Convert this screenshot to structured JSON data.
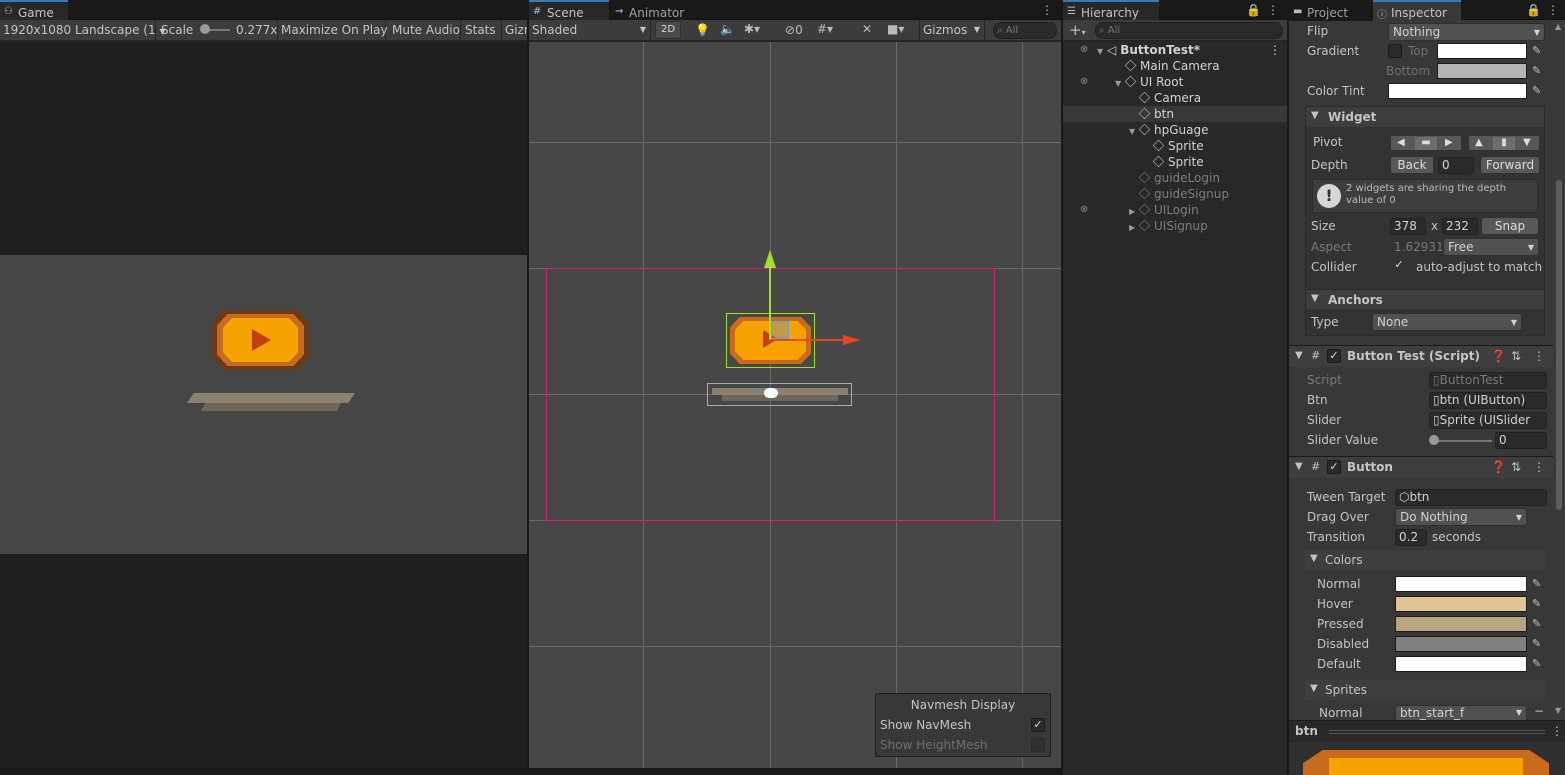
{
  "game": {
    "tab": "Game",
    "resolution": "1920x1080 Landscape (1",
    "scale_label": "Scale",
    "scale_value": "0.277x",
    "maximize": "Maximize On Play",
    "mute": "Mute Audio",
    "stats": "Stats",
    "gizmos": "Gizm"
  },
  "scene": {
    "tab": "Scene",
    "animator_tab": "Animator",
    "shading": "Shaded",
    "mode2d": "2D",
    "hidden_count": "0",
    "gizmos": "Gizmos",
    "search_placeholder": "All",
    "navmesh": {
      "title": "Navmesh Display",
      "show_navmesh": "Show NavMesh",
      "show_navmesh_checked": true,
      "show_heightmesh": "Show HeightMesh",
      "show_heightmesh_checked": false
    }
  },
  "hierarchy": {
    "tab": "Hierarchy",
    "search_placeholder": "All",
    "add": "+",
    "items": [
      {
        "label": "ButtonTest*",
        "depth": 0,
        "fold": "open",
        "dim": false
      },
      {
        "label": "Main Camera",
        "depth": 1,
        "fold": "",
        "dim": false
      },
      {
        "label": "UI Root",
        "depth": 1,
        "fold": "open",
        "dim": false
      },
      {
        "label": "Camera",
        "depth": 2,
        "fold": "",
        "dim": false
      },
      {
        "label": "btn",
        "depth": 2,
        "fold": "",
        "dim": false,
        "selected": true
      },
      {
        "label": "hpGuage",
        "depth": 2,
        "fold": "open",
        "dim": false
      },
      {
        "label": "Sprite",
        "depth": 3,
        "fold": "",
        "dim": false
      },
      {
        "label": "Sprite",
        "depth": 3,
        "fold": "",
        "dim": false
      },
      {
        "label": "guideLogin",
        "depth": 2,
        "fold": "",
        "dim": true
      },
      {
        "label": "guideSignup",
        "depth": 2,
        "fold": "",
        "dim": true
      },
      {
        "label": "UILogin",
        "depth": 2,
        "fold": "closed",
        "dim": true
      },
      {
        "label": "UISignup",
        "depth": 2,
        "fold": "closed",
        "dim": true
      }
    ]
  },
  "inspector": {
    "project_tab": "Project",
    "inspector_tab": "Inspector",
    "flip_label": "Flip",
    "flip_value": "Nothing",
    "gradient_label": "Gradient",
    "top_label": "Top",
    "bottom_label": "Bottom",
    "color_tint_label": "Color Tint",
    "widget": {
      "title": "Widget",
      "pivot_label": "Pivot",
      "depth_label": "Depth",
      "back": "Back",
      "depth_value": "0",
      "forward": "Forward",
      "warning": "2 widgets are sharing the depth value of 0",
      "size_label": "Size",
      "width": "378",
      "x": "x",
      "height": "232",
      "snap": "Snap",
      "aspect_label": "Aspect",
      "aspect_value": "1.62931",
      "aspect_mode": "Free",
      "collider_label": "Collider",
      "collider_text": "auto-adjust to match"
    },
    "anchors": {
      "title": "Anchors",
      "type_label": "Type",
      "type_value": "None"
    },
    "button_test": {
      "title": "Button Test (Script)",
      "script_label": "Script",
      "script_value": "ButtonTest",
      "btn_label": "Btn",
      "btn_value": "btn (UIButton)",
      "slider_label": "Slider",
      "slider_value": "Sprite (UISlider",
      "slider_value_label": "Slider Value",
      "slider_value_num": "0"
    },
    "button": {
      "title": "Button",
      "tween_label": "Tween Target",
      "tween_value": "btn",
      "drag_label": "Drag Over",
      "drag_value": "Do Nothing",
      "transition_label": "Transition",
      "transition_value": "0.2",
      "seconds": "seconds",
      "colors_title": "Colors",
      "normal": "Normal",
      "hover": "Hover",
      "pressed": "Pressed",
      "disabled": "Disabled",
      "default": "Default",
      "sprites_title": "Sprites",
      "sprite_normal": "Normal",
      "sprite_normal_value": "btn_start_f"
    },
    "preview_title": "btn"
  },
  "colors": {
    "accent": "#3a79bb",
    "white": "#ffffff",
    "hover": "#e1c695",
    "pressed": "#b7a481",
    "disabled": "#808080",
    "bottom_gradient": "#b4b4b4",
    "rect": "#d51e7a",
    "gizmo_y": "#9be22c",
    "gizmo_x": "#e8471e",
    "button_orange": "#f6a300"
  }
}
